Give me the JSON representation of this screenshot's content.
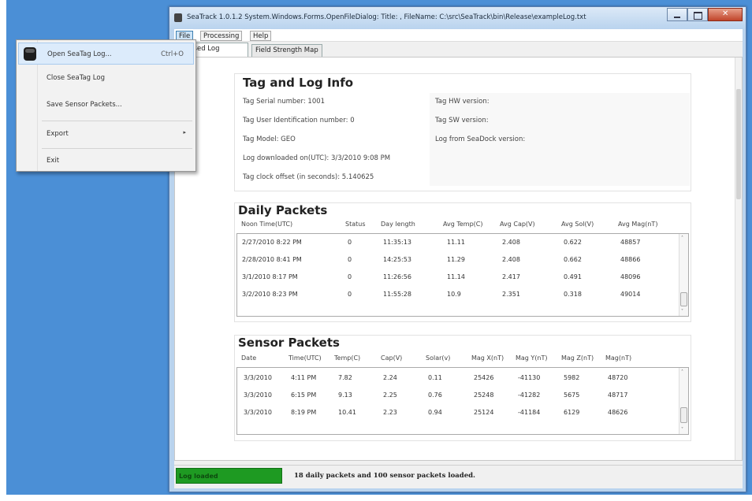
{
  "window": {
    "title": "SeaTrack 1.0.1.2 System.Windows.Forms.OpenFileDialog: Title: , FileName: C:\\src\\SeaTrack\\bin\\Release\\exampleLog.txt"
  },
  "menubar": {
    "items": [
      "File",
      "Processing",
      "Help"
    ]
  },
  "tabs": [
    "ocessed Log",
    "Field Strength Map"
  ],
  "file_menu": {
    "open_label": "Open SeaTag Log...",
    "open_shortcut": "Ctrl+O",
    "close_label": "Close SeaTag Log",
    "save_label": "Save Sensor Packets...",
    "export_label": "Export",
    "export_arrow": "▸",
    "exit_label": "Exit"
  },
  "info": {
    "title": "Tag and Log Info",
    "left": [
      "Tag Serial number: 1001",
      "Tag User Identification number: 0",
      "Tag Model: GEO",
      "Log downloaded on(UTC): 3/3/2010 9:08 PM",
      "Tag clock offset (in seconds): 5.140625"
    ],
    "right": [
      "Tag HW version:",
      "Tag SW version:",
      "Log from SeaDock version:"
    ]
  },
  "daily": {
    "title": "Daily Packets",
    "headers": [
      "Noon Time(UTC)",
      "Status",
      "Day length",
      "Avg Temp(C)",
      "Avg Cap(V)",
      "Avg Sol(V)",
      "Avg Mag(nT)"
    ],
    "rows": [
      [
        "2/27/2010 8:22 PM",
        "0",
        "11:35:13",
        "11.11",
        "2.408",
        "0.622",
        "48857"
      ],
      [
        "2/28/2010 8:41 PM",
        "0",
        "14:25:53",
        "11.29",
        "2.408",
        "0.662",
        "48866"
      ],
      [
        "3/1/2010 8:17 PM",
        "0",
        "11:26:56",
        "11.14",
        "2.417",
        "0.491",
        "48096"
      ],
      [
        "3/2/2010 8:23 PM",
        "0",
        "11:55:28",
        "10.9",
        "2.351",
        "0.318",
        "49014"
      ]
    ]
  },
  "sensor": {
    "title": "Sensor Packets",
    "headers": [
      "Date",
      "Time(UTC)",
      "Temp(C)",
      "Cap(V)",
      "Solar(v)",
      "Mag X(nT)",
      "Mag Y(nT)",
      "Mag Z(nT)",
      "Mag(nT)"
    ],
    "rows": [
      [
        "3/3/2010",
        "4:11 PM",
        "7.82",
        "2.24",
        "0.11",
        "25426",
        "-41130",
        "5982",
        "48720"
      ],
      [
        "3/3/2010",
        "6:15 PM",
        "9.13",
        "2.25",
        "0.76",
        "25248",
        "-41282",
        "5675",
        "48717"
      ],
      [
        "3/3/2010",
        "8:19 PM",
        "10.41",
        "2.23",
        "0.94",
        "25124",
        "-41184",
        "6129",
        "48626"
      ]
    ]
  },
  "status": {
    "indicator": "Log loaded",
    "message": "18 daily packets and 100 sensor packets loaded.",
    "indicator_color": "#1e9a22"
  },
  "icons": {
    "scroll_up": "˄",
    "scroll_down": "˅"
  }
}
